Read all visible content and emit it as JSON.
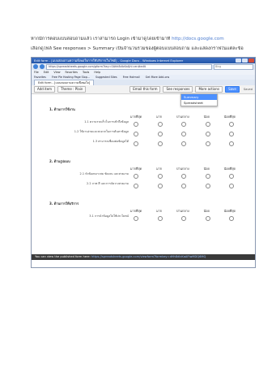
{
  "caption": {
    "line1_text": "หากมีการตอบแบบสอบถามแล้ว เราสามารถ Login เข้ามาดูโดยเข้ามาที่",
    "line1_link": "http://docs.google.com",
    "line2_text": "เลือกดูไฟล์ See responses > Summary เป็นจำนวนรวมของผู้ตอบแบบสอบถาม และแสดงกราฟในแต่ละข้อ"
  },
  "browser": {
    "title": "Edit form - [แบบสอบถามความพึงพอใจการใช้บริการเว็บไซต์] - Google Docs - Windows Internet Explorer",
    "url": "https://spreadsheets.google.com/gform?key=0Ahh8dIcKa&hl=en#edit",
    "search_placeholder": "Bing",
    "menu": [
      "File",
      "Edit",
      "View",
      "Favorites",
      "Tools",
      "Help"
    ],
    "favorites": [
      "Favorites",
      "Free Ple Hosting Page Slop...",
      "Suggested Sites",
      "Free Hotmail",
      "Get More Add-ons"
    ],
    "tab": "Edit form - [แบบสอบถามความพึงพอใจ]"
  },
  "form_toolbar": {
    "add_item": "Add item",
    "theme": "Theme : Plain",
    "email": "Email this form",
    "see_responses": "See responses",
    "more_actions": "More actions",
    "save": "Save",
    "saved_status": "Saved"
  },
  "responses_menu": [
    "Summary",
    "Spreadsheet"
  ],
  "form": {
    "scale_headers": [
      "มากที่สุด",
      "มาก",
      "ปานกลาง",
      "น้อย",
      "น้อยที่สุด"
    ],
    "sections": [
      {
        "title": "1. ด้านการใช้งาน",
        "questions": [
          "1.1 ความรวดเร็วในการเข้าถึงข้อมูล",
          "1.2 ใช้งานง่ายและสะดวกในการค้นหาข้อมูล",
          "1.3 สามารถเชื่อมต่อข้อมูลได้"
        ]
      },
      {
        "title": "2. ด้านรูปแบบ",
        "questions": [
          "2.1 หัวข้อเหมาะสม ชัดเจน และสวยงาม",
          "2.2 ภาพ สี และการจัดวางสวยงาม"
        ]
      },
      {
        "title": "3. ด้านการให้บริการ",
        "questions": [
          "3.1 การนำข้อมูลไปใช้ประโยชน์"
        ]
      }
    ]
  },
  "published_bar": {
    "text": "You can view the published form here:",
    "link": "https://spreadsheets.google.com/viewform?formkey=dHh8dIcKaAFlwMDQ6MQ"
  }
}
